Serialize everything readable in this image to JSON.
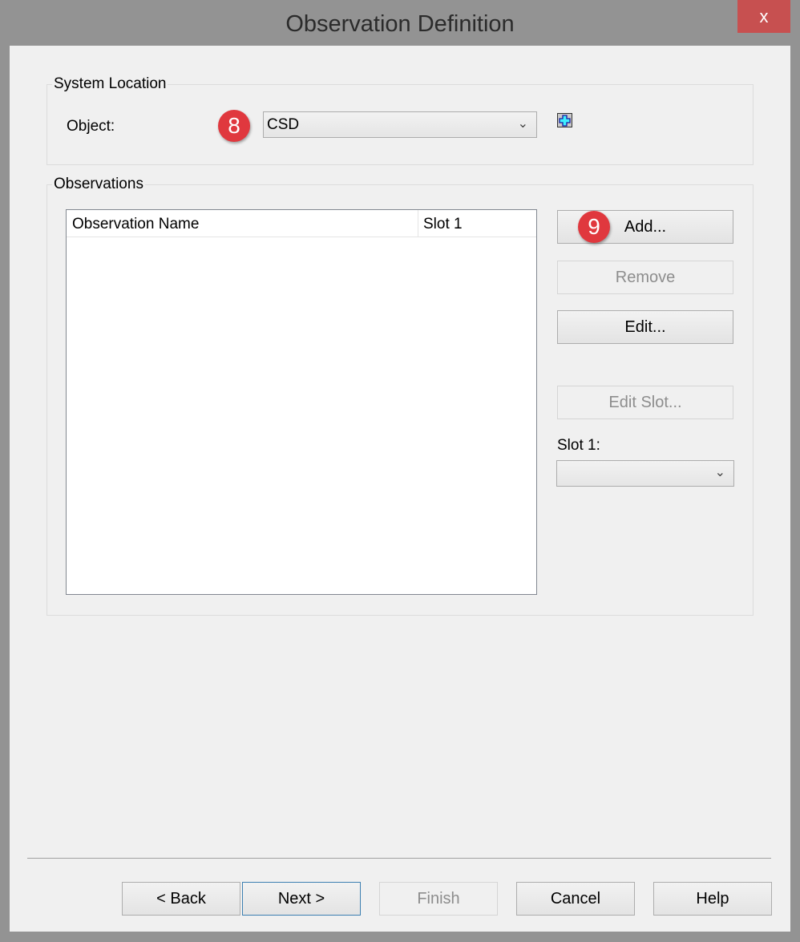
{
  "window": {
    "title": "Observation Definition",
    "close_label": "x"
  },
  "system_location": {
    "label": "System Location",
    "object_label": "Object:",
    "object_value": "CSD",
    "badge": "8",
    "add_icon": "plus-icon"
  },
  "observations": {
    "label": "Observations",
    "columns": [
      "Observation Name",
      "Slot 1"
    ],
    "rows": [],
    "buttons": {
      "add": "Add...",
      "add_badge": "9",
      "remove": "Remove",
      "edit": "Edit...",
      "edit_slot": "Edit Slot..."
    },
    "slot_label": "Slot 1:",
    "slot_value": ""
  },
  "footer": {
    "back": "< Back",
    "next": "Next >",
    "finish": "Finish",
    "cancel": "Cancel",
    "help": "Help"
  }
}
